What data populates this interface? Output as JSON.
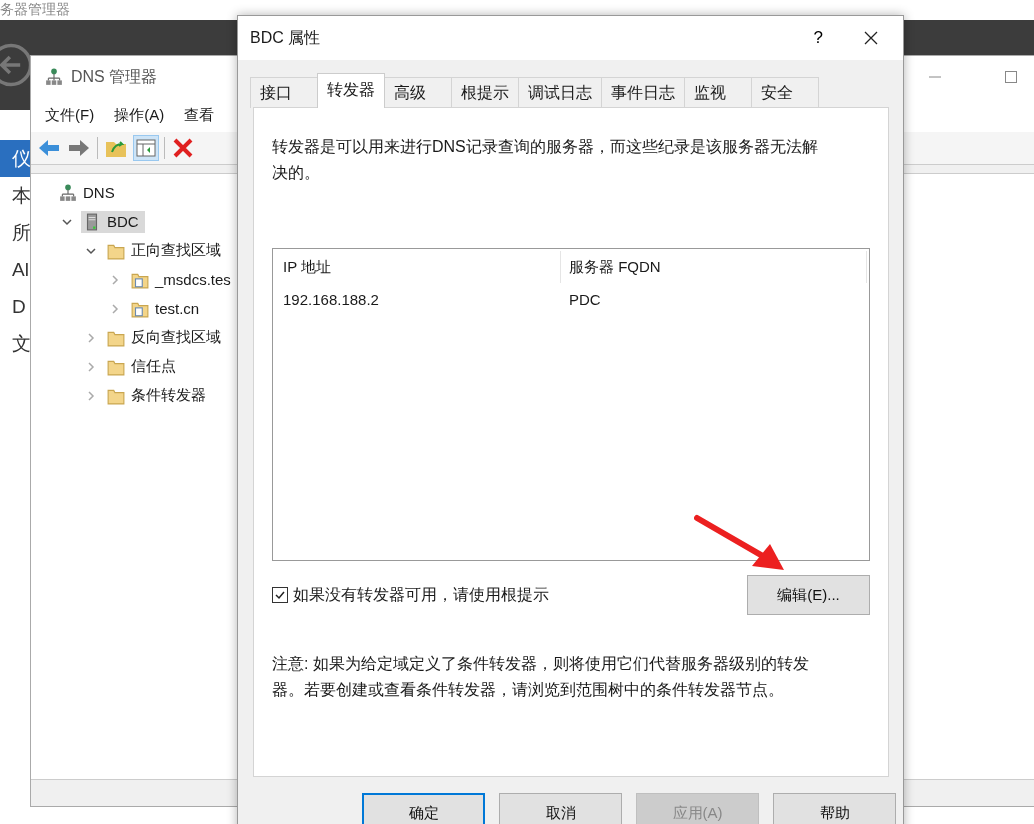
{
  "server_manager": {
    "title": "务器管理器",
    "nav_items": [
      {
        "label": "仪",
        "selected": true
      },
      {
        "label": "本",
        "selected": false
      },
      {
        "label": "所",
        "selected": false
      },
      {
        "label": "Al",
        "selected": false
      },
      {
        "label": "D",
        "selected": false
      },
      {
        "label": "文",
        "selected": false
      }
    ]
  },
  "dns_manager": {
    "title": "DNS 管理器",
    "menu": [
      "文件(F)",
      "操作(A)",
      "查看"
    ],
    "tree": [
      {
        "label": "DNS",
        "kind": "root",
        "selected": false,
        "children": [
          {
            "label": "BDC",
            "kind": "server",
            "selected": true,
            "expanded": true,
            "children": [
              {
                "label": "正向查找区域",
                "kind": "folder",
                "selected": false,
                "expanded": true,
                "children": [
                  {
                    "label": "_msdcs.tes",
                    "kind": "zone",
                    "selected": false,
                    "expanded": false
                  },
                  {
                    "label": "test.cn",
                    "kind": "zone",
                    "selected": false,
                    "expanded": false
                  }
                ]
              },
              {
                "label": "反向查找区域",
                "kind": "folder",
                "selected": false,
                "expanded": false
              },
              {
                "label": "信任点",
                "kind": "folder",
                "selected": false,
                "expanded": false
              },
              {
                "label": "条件转发器",
                "kind": "folder",
                "selected": false,
                "expanded": false
              }
            ]
          }
        ]
      }
    ]
  },
  "dialog": {
    "title": "BDC 属性",
    "help": "?",
    "tabs": [
      {
        "label": "接口",
        "selected": false
      },
      {
        "label": "转发器",
        "selected": true
      },
      {
        "label": "高级",
        "selected": false
      },
      {
        "label": "根提示",
        "selected": false
      },
      {
        "label": "调试日志",
        "selected": false
      },
      {
        "label": "事件日志",
        "selected": false
      },
      {
        "label": "监视",
        "selected": false
      },
      {
        "label": "安全",
        "selected": false
      }
    ],
    "description": "转发器是可以用来进行DNS记录查询的服务器，而这些纪录是该服务器无法解决的。",
    "table": {
      "columns": [
        "IP 地址",
        "服务器 FQDN"
      ],
      "rows": [
        [
          "192.168.188.2",
          "PDC"
        ]
      ]
    },
    "use_root_hints": {
      "label": "如果没有转发器可用，请使用根提示",
      "checked": true
    },
    "edit_button": "编辑(E)...",
    "note": "注意: 如果为给定域定义了条件转发器，则将使用它们代替服务器级别的转发器。若要创建或查看条件转发器，请浏览到范围树中的条件转发器节点。",
    "buttons": [
      {
        "label": "确定",
        "kind": "default",
        "disabled": false
      },
      {
        "label": "取消",
        "kind": "normal",
        "disabled": false
      },
      {
        "label": "应用(A)",
        "kind": "normal",
        "disabled": true
      },
      {
        "label": "帮助",
        "kind": "normal",
        "disabled": false
      }
    ]
  }
}
